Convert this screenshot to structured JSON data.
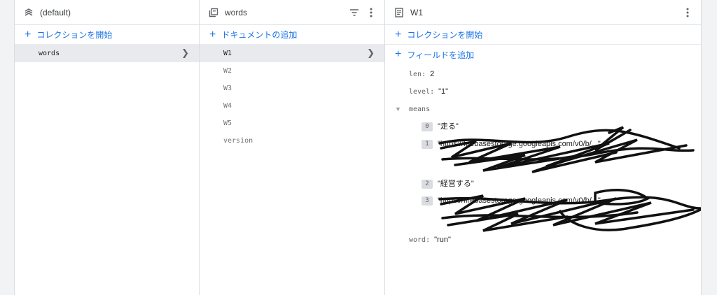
{
  "panel1": {
    "title": "(default)",
    "add_label": "コレクションを開始",
    "items": [
      {
        "label": "words",
        "selected": true
      }
    ]
  },
  "panel2": {
    "title": "words",
    "add_label": "ドキュメントの追加",
    "items": [
      {
        "label": "W1",
        "selected": true
      },
      {
        "label": "W2"
      },
      {
        "label": "W3"
      },
      {
        "label": "W4"
      },
      {
        "label": "W5"
      },
      {
        "label": "version"
      }
    ]
  },
  "panel3": {
    "title": "W1",
    "add_collection_label": "コレクションを開始",
    "add_field_label": "フィールドを追加",
    "fields": {
      "len": {
        "key": "len:",
        "value": "2"
      },
      "level": {
        "key": "level:",
        "value": "\"1\""
      },
      "means": {
        "key": "means",
        "items": [
          {
            "index": "0",
            "value": "\"走る\""
          },
          {
            "index": "1",
            "value": "\"https://firebasestorage.googleapis.com/v0/b/...\""
          },
          {
            "index": "2",
            "value": "\"経営する\""
          },
          {
            "index": "3",
            "value": "\"https://firebasestorage.googleapis.com/v0/b/...\""
          }
        ]
      },
      "word": {
        "key": "word:",
        "value": "\"run\""
      }
    }
  },
  "icons": {
    "panel1": "database-icon",
    "panel2": "collection-icon",
    "panel3": "document-icon",
    "filter": "filter-icon",
    "more": "more-vert-icon",
    "chevron": "chevron-right-icon",
    "toggle": "expand-toggle-icon"
  },
  "colors": {
    "accent": "#1a73e8",
    "selected_bg": "#e8eaed",
    "border": "#dadce0"
  }
}
